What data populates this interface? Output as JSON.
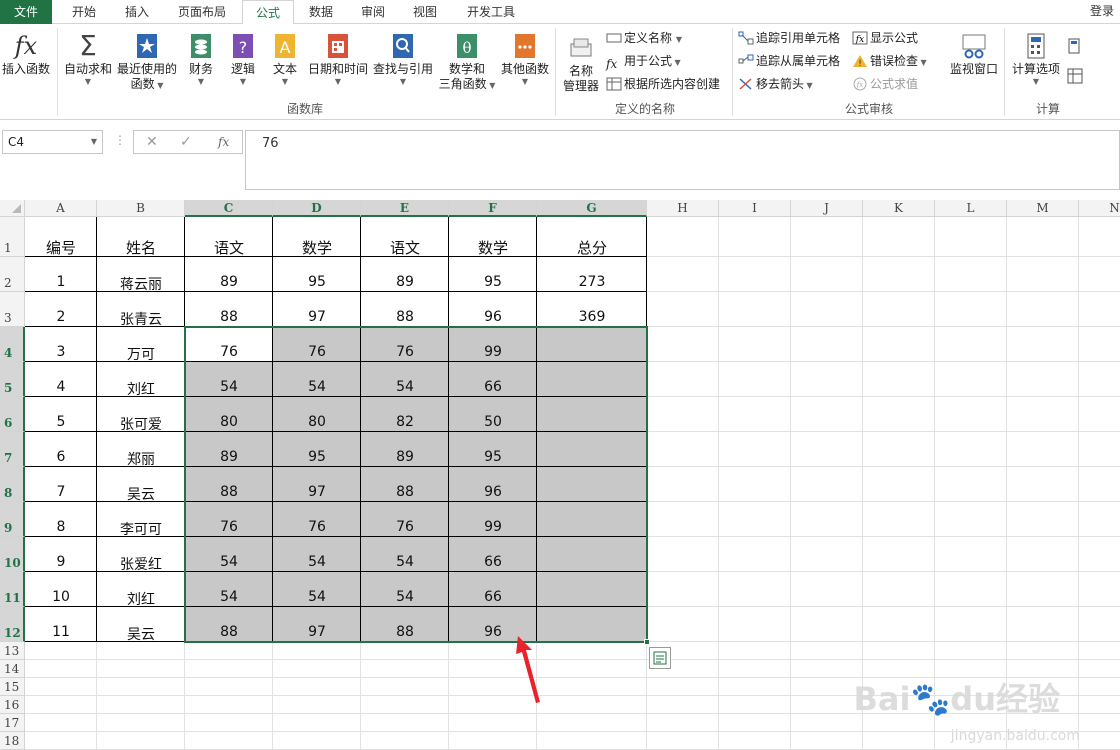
{
  "tabs": [
    "文件",
    "开始",
    "插入",
    "页面布局",
    "公式",
    "数据",
    "审阅",
    "视图",
    "开发工具"
  ],
  "login": "登录",
  "ribbon": {
    "insert_function": "插入函数",
    "autosum": "自动求和",
    "recent": [
      "最近使用的",
      "函数"
    ],
    "finance": "财务",
    "logic": "逻辑",
    "text": "文本",
    "datetime": "日期和时间",
    "lookup": "查找与引用",
    "math": [
      "数学和",
      "三角函数"
    ],
    "other": "其他函数",
    "group_library": "函数库",
    "name_manager": [
      "名称",
      "管理器"
    ],
    "define_name": "定义名称",
    "use_in_formula": "用于公式",
    "create_from_selection": "根据所选内容创建",
    "group_names": "定义的名称",
    "trace_precedents": "追踪引用单元格",
    "trace_dependents": "追踪从属单元格",
    "remove_arrows": "移去箭头",
    "show_formulas": "显示公式",
    "error_checking": "错误检查",
    "evaluate_formula": "公式求值",
    "group_audit": "公式审核",
    "watch_window": "监视窗口",
    "calc_options": "计算选项",
    "group_calc": "计算"
  },
  "formula_bar": {
    "name_box": "C4",
    "fx": "fx",
    "value": "76"
  },
  "columns": [
    "A",
    "B",
    "C",
    "D",
    "E",
    "F",
    "G",
    "H",
    "I",
    "J",
    "K",
    "L",
    "M",
    "N"
  ],
  "rows": [
    "1",
    "2",
    "3",
    "4",
    "5",
    "6",
    "7",
    "8",
    "9",
    "10",
    "11",
    "12",
    "13",
    "14",
    "15",
    "16",
    "17",
    "18"
  ],
  "table": {
    "headers": [
      "编号",
      "姓名",
      "语文",
      "数学",
      "语文",
      "数学",
      "总分"
    ],
    "rows": [
      [
        "1",
        "蒋云丽",
        "89",
        "95",
        "89",
        "95",
        "273"
      ],
      [
        "2",
        "张青云",
        "88",
        "97",
        "88",
        "96",
        "369"
      ],
      [
        "3",
        "万可",
        "76",
        "76",
        "76",
        "99",
        ""
      ],
      [
        "4",
        "刘红",
        "54",
        "54",
        "54",
        "66",
        ""
      ],
      [
        "5",
        "张可爱",
        "80",
        "80",
        "82",
        "50",
        ""
      ],
      [
        "6",
        "郑丽",
        "89",
        "95",
        "89",
        "95",
        ""
      ],
      [
        "7",
        "吴云",
        "88",
        "97",
        "88",
        "96",
        ""
      ],
      [
        "8",
        "李可可",
        "76",
        "76",
        "76",
        "99",
        ""
      ],
      [
        "9",
        "张爱红",
        "54",
        "54",
        "54",
        "66",
        ""
      ],
      [
        "10",
        "刘红",
        "54",
        "54",
        "54",
        "66",
        ""
      ],
      [
        "11",
        "吴云",
        "88",
        "97",
        "88",
        "96",
        ""
      ]
    ]
  },
  "watermark": {
    "brand": "Baidu经验",
    "url": "jingyan.baidu.com"
  },
  "colors": {
    "accent": "#217346",
    "selection_fill": "#c8c8c8",
    "annotation_arrow": "#e8232c"
  }
}
